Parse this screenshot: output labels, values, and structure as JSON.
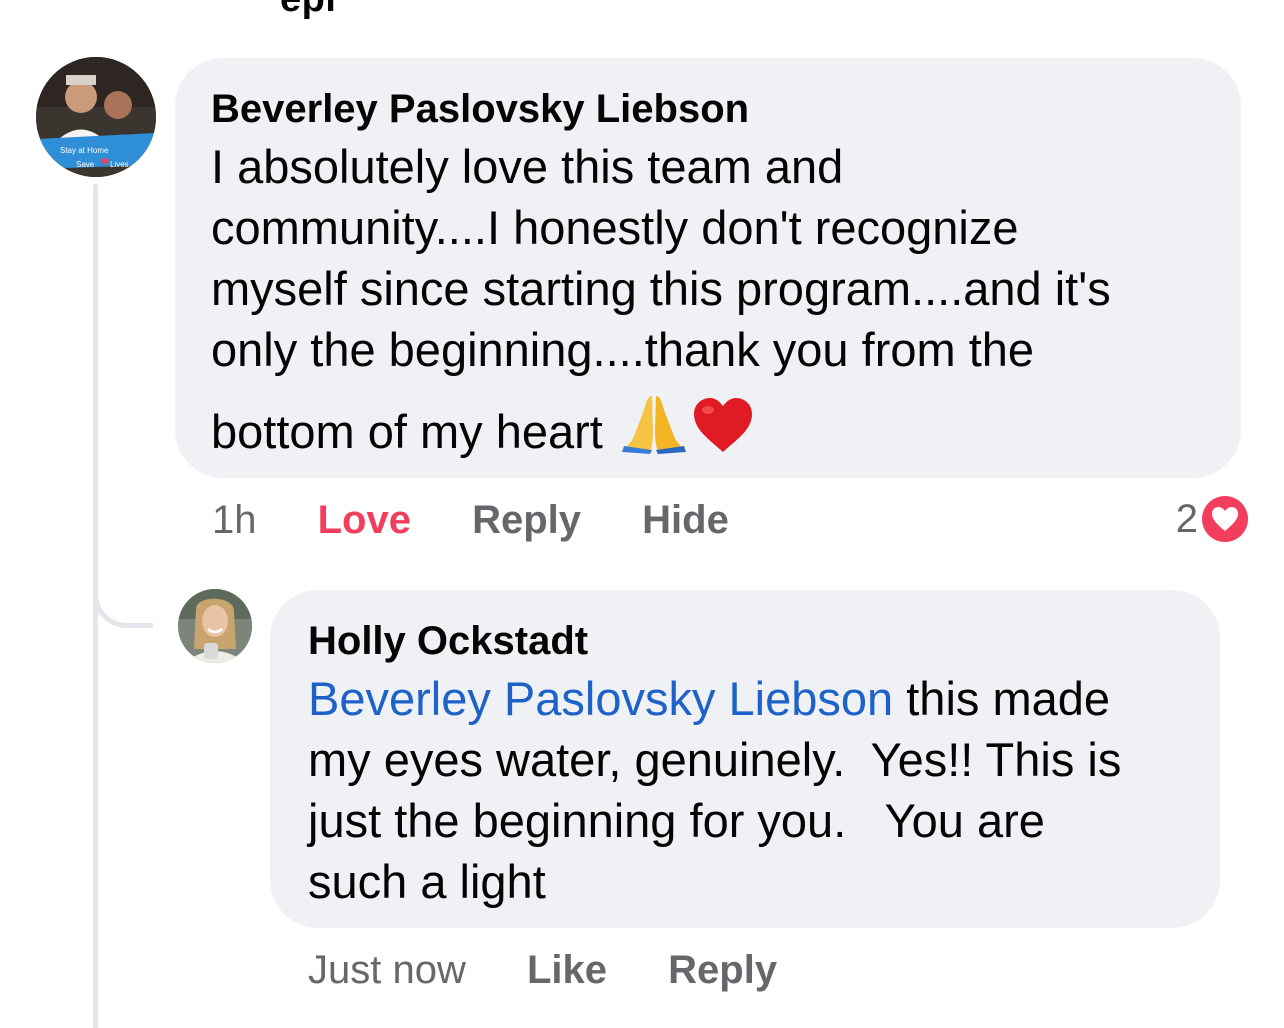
{
  "top_partial_text": "epl",
  "comments": [
    {
      "author": "Beverley Paslovsky Liebson",
      "text_lines": [
        "I absolutely love this team and",
        "community....I honestly don't recognize",
        "myself since starting this program....and it's",
        "only the beginning....thank you from the",
        "bottom of my heart"
      ],
      "emojis": [
        "folded-hands-emoji",
        "red-heart-emoji"
      ],
      "avatar_caption_1": "Stay at Home",
      "avatar_caption_2": "Save",
      "avatar_caption_3": "Lives",
      "time": "1h",
      "actions": {
        "love": "Love",
        "reply": "Reply",
        "hide": "Hide"
      },
      "reaction_count": "2",
      "reaction_icon": "heart-icon"
    },
    {
      "author": "Holly Ockstadt",
      "mention": "Beverley Paslovsky Liebson",
      "text_lines": [
        " this made",
        "my eyes water, genuinely.  Yes!! This is",
        "just the beginning for you.   You are",
        "such a light"
      ],
      "time": "Just now",
      "actions": {
        "like": "Like",
        "reply": "Reply"
      }
    }
  ],
  "colors": {
    "bubble": "#f0f1f5",
    "love": "#f23e5c",
    "mention": "#1d62c9",
    "meta": "#65676b"
  }
}
